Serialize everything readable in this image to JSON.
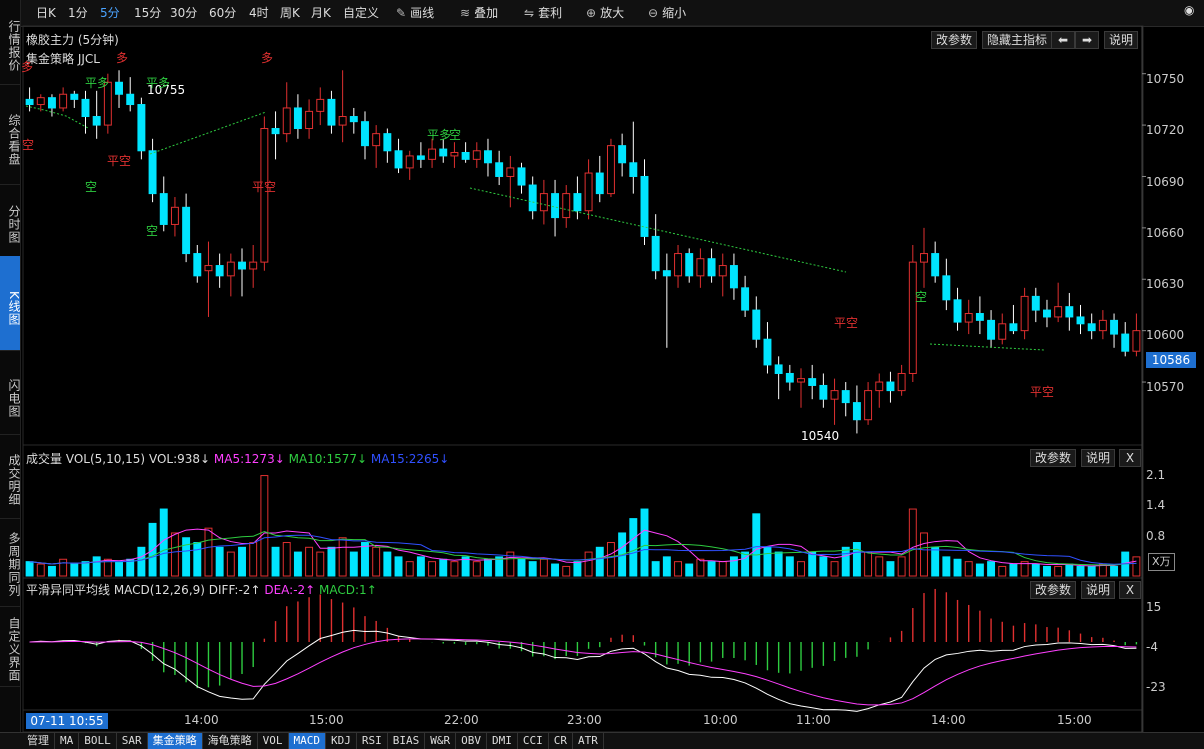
{
  "toolbar": {
    "items": [
      "日K",
      "1分",
      "5分",
      "15分",
      "30分",
      "60分",
      "4时",
      "周K",
      "月K",
      "自定义"
    ],
    "active_index": 2,
    "draw_label": "画线",
    "overlay_label": "叠加",
    "arbitrage_label": "套利",
    "zoom_in_label": "放大",
    "zoom_out_label": "缩小"
  },
  "left_tabs": [
    "行情报价",
    "综合看盘",
    "分时图",
    "K线图",
    "闪电图",
    "成交明细",
    "多周期同列",
    "自定义界面"
  ],
  "left_active_index": 3,
  "main_panel": {
    "title": "橡胶主力 (5分钟)",
    "strategy": "集金策略 JJCL",
    "btn_params": "改参数",
    "btn_hide": "隐藏主指标",
    "btn_help": "说明",
    "high_label": "10755",
    "low_label": "10540",
    "current_price": "10586",
    "y_labels": [
      "10750",
      "10720",
      "10690",
      "10660",
      "10630",
      "10600",
      "10570"
    ]
  },
  "signals": [
    {
      "text": "多",
      "color": "#e03030"
    },
    {
      "text": "空",
      "color": "#e03030"
    },
    {
      "text": "平多",
      "color": "#2ecc40"
    },
    {
      "text": "空",
      "color": "#2ecc40"
    },
    {
      "text": "多",
      "color": "#e03030"
    },
    {
      "text": "平空",
      "color": "#e03030"
    },
    {
      "text": "平多",
      "color": "#2ecc40"
    },
    {
      "text": "空",
      "color": "#2ecc40"
    },
    {
      "text": "多",
      "color": "#e03030"
    },
    {
      "text": "平空",
      "color": "#e03030"
    },
    {
      "text": "平多",
      "color": "#2ecc40"
    },
    {
      "text": "空",
      "color": "#2ecc40"
    },
    {
      "text": "平空",
      "color": "#e03030"
    },
    {
      "text": "空",
      "color": "#2ecc40"
    },
    {
      "text": "平空",
      "color": "#e03030"
    }
  ],
  "volume_panel": {
    "title": "成交量 VOL(5,10,15)",
    "vol": "VOL:938↓",
    "ma5": "MA5:1273↓",
    "ma10": "MA10:1577↓",
    "ma15": "MA15:2265↓",
    "btn_params": "改参数",
    "btn_help": "说明",
    "btn_close": "X",
    "unit": "X万",
    "y_labels": [
      "2.1",
      "1.4",
      "0.8"
    ]
  },
  "macd_panel": {
    "title": "平滑异同平均线 MACD(12,26,9)",
    "diff": "DIFF:-2↑",
    "dea": "DEA:-2↑",
    "macd": "MACD:1↑",
    "btn_params": "改参数",
    "btn_help": "说明",
    "btn_close": "X",
    "y_labels": [
      "15",
      "-4",
      "-23"
    ]
  },
  "time_axis": {
    "current": "07-11 10:55",
    "labels": [
      "14:00",
      "15:00",
      "22:00",
      "23:00",
      "10:00",
      "11:00",
      "14:00",
      "15:00"
    ]
  },
  "bottom_tabs": [
    "管理",
    "MA",
    "BOLL",
    "SAR",
    "集金策略",
    "海龟策略",
    "VOL",
    "MACD",
    "KDJ",
    "RSI",
    "BIAS",
    "W&R",
    "OBV",
    "DMI",
    "CCI",
    "CR",
    "ATR"
  ],
  "bottom_active": [
    4,
    7
  ],
  "colors": {
    "up": "#e03030",
    "down": "#00e5ff",
    "ma5": "#ff40ff",
    "ma10": "#2ecc40",
    "ma15": "#3050ff",
    "diff": "#ffffff",
    "dea": "#ff40ff"
  },
  "chart_data": {
    "type": "candlestick",
    "price_ylim": [
      10535,
      10765
    ],
    "ohlc": [
      [
        10735,
        10742,
        10728,
        10732
      ],
      [
        10732,
        10738,
        10728,
        10736
      ],
      [
        10736,
        10738,
        10725,
        10730
      ],
      [
        10730,
        10742,
        10728,
        10738
      ],
      [
        10738,
        10740,
        10730,
        10735
      ],
      [
        10735,
        10740,
        10715,
        10725
      ],
      [
        10725,
        10740,
        10712,
        10720
      ],
      [
        10720,
        10750,
        10715,
        10745
      ],
      [
        10745,
        10752,
        10730,
        10738
      ],
      [
        10738,
        10748,
        10728,
        10732
      ],
      [
        10732,
        10736,
        10700,
        10705
      ],
      [
        10705,
        10712,
        10675,
        10680
      ],
      [
        10680,
        10690,
        10658,
        10662
      ],
      [
        10662,
        10678,
        10655,
        10672
      ],
      [
        10672,
        10680,
        10640,
        10645
      ],
      [
        10645,
        10650,
        10628,
        10632
      ],
      [
        10635,
        10652,
        10608,
        10638
      ],
      [
        10638,
        10645,
        10625,
        10632
      ],
      [
        10632,
        10645,
        10620,
        10640
      ],
      [
        10640,
        10648,
        10620,
        10636
      ],
      [
        10636,
        10650,
        10625,
        10640
      ],
      [
        10640,
        10725,
        10635,
        10718
      ],
      [
        10718,
        10728,
        10700,
        10715
      ],
      [
        10715,
        10745,
        10710,
        10730
      ],
      [
        10730,
        10738,
        10712,
        10718
      ],
      [
        10718,
        10735,
        10712,
        10728
      ],
      [
        10728,
        10742,
        10720,
        10735
      ],
      [
        10735,
        10740,
        10715,
        10720
      ],
      [
        10720,
        10752,
        10710,
        10725
      ],
      [
        10725,
        10730,
        10715,
        10722
      ],
      [
        10722,
        10728,
        10700,
        10708
      ],
      [
        10708,
        10720,
        10695,
        10715
      ],
      [
        10715,
        10718,
        10698,
        10705
      ],
      [
        10705,
        10712,
        10692,
        10695
      ],
      [
        10695,
        10705,
        10688,
        10702
      ],
      [
        10702,
        10710,
        10695,
        10700
      ],
      [
        10700,
        10712,
        10695,
        10706
      ],
      [
        10706,
        10712,
        10698,
        10702
      ],
      [
        10702,
        10710,
        10695,
        10704
      ],
      [
        10704,
        10710,
        10698,
        10700
      ],
      [
        10700,
        10710,
        10695,
        10705
      ],
      [
        10705,
        10712,
        10690,
        10698
      ],
      [
        10698,
        10705,
        10685,
        10690
      ],
      [
        10690,
        10702,
        10672,
        10695
      ],
      [
        10695,
        10698,
        10680,
        10685
      ],
      [
        10685,
        10690,
        10665,
        10670
      ],
      [
        10670,
        10688,
        10662,
        10680
      ],
      [
        10680,
        10688,
        10655,
        10666
      ],
      [
        10666,
        10685,
        10660,
        10680
      ],
      [
        10680,
        10690,
        10665,
        10670
      ],
      [
        10670,
        10700,
        10665,
        10692
      ],
      [
        10692,
        10702,
        10675,
        10680
      ],
      [
        10680,
        10712,
        10678,
        10708
      ],
      [
        10708,
        10715,
        10690,
        10698
      ],
      [
        10698,
        10722,
        10680,
        10690
      ],
      [
        10690,
        10700,
        10650,
        10655
      ],
      [
        10655,
        10668,
        10630,
        10635
      ],
      [
        10635,
        10645,
        10590,
        10632
      ],
      [
        10632,
        10650,
        10625,
        10645
      ],
      [
        10645,
        10648,
        10628,
        10632
      ],
      [
        10632,
        10648,
        10625,
        10642
      ],
      [
        10642,
        10648,
        10628,
        10632
      ],
      [
        10632,
        10645,
        10620,
        10638
      ],
      [
        10638,
        10645,
        10618,
        10625
      ],
      [
        10625,
        10632,
        10608,
        10612
      ],
      [
        10612,
        10620,
        10590,
        10595
      ],
      [
        10595,
        10605,
        10575,
        10580
      ],
      [
        10580,
        10585,
        10560,
        10575
      ],
      [
        10575,
        10580,
        10565,
        10570
      ],
      [
        10570,
        10578,
        10555,
        10572
      ],
      [
        10572,
        10580,
        10560,
        10568
      ],
      [
        10568,
        10575,
        10555,
        10560
      ],
      [
        10560,
        10572,
        10545,
        10565
      ],
      [
        10565,
        10570,
        10550,
        10558
      ],
      [
        10558,
        10568,
        10540,
        10548
      ],
      [
        10548,
        10570,
        10545,
        10565
      ],
      [
        10565,
        10575,
        10555,
        10570
      ],
      [
        10570,
        10576,
        10558,
        10565
      ],
      [
        10565,
        10580,
        10562,
        10575
      ],
      [
        10575,
        10650,
        10570,
        10640
      ],
      [
        10640,
        10660,
        10625,
        10645
      ],
      [
        10645,
        10652,
        10628,
        10632
      ],
      [
        10632,
        10642,
        10612,
        10618
      ],
      [
        10618,
        10625,
        10600,
        10605
      ],
      [
        10605,
        10618,
        10598,
        10610
      ],
      [
        10610,
        10620,
        10598,
        10606
      ],
      [
        10606,
        10612,
        10590,
        10595
      ],
      [
        10595,
        10610,
        10592,
        10604
      ],
      [
        10604,
        10615,
        10598,
        10600
      ],
      [
        10600,
        10625,
        10595,
        10620
      ],
      [
        10620,
        10625,
        10605,
        10612
      ],
      [
        10612,
        10618,
        10602,
        10608
      ],
      [
        10608,
        10628,
        10605,
        10614
      ],
      [
        10614,
        10622,
        10600,
        10608
      ],
      [
        10608,
        10615,
        10598,
        10604
      ],
      [
        10604,
        10610,
        10595,
        10600
      ],
      [
        10600,
        10612,
        10595,
        10606
      ],
      [
        10606,
        10610,
        10590,
        10598
      ],
      [
        10598,
        10605,
        10585,
        10588
      ],
      [
        10588,
        10610,
        10585,
        10600
      ]
    ],
    "volume": [
      0.3,
      0.25,
      0.2,
      0.35,
      0.25,
      0.3,
      0.4,
      0.35,
      0.3,
      0.35,
      0.6,
      1.1,
      1.4,
      0.9,
      0.8,
      0.7,
      1.0,
      0.6,
      0.5,
      0.6,
      0.7,
      2.1,
      0.6,
      0.7,
      0.5,
      0.6,
      0.5,
      0.6,
      0.8,
      0.5,
      0.7,
      0.6,
      0.5,
      0.4,
      0.3,
      0.4,
      0.3,
      0.35,
      0.3,
      0.4,
      0.3,
      0.35,
      0.4,
      0.5,
      0.35,
      0.3,
      0.35,
      0.25,
      0.2,
      0.3,
      0.5,
      0.6,
      0.7,
      0.9,
      1.2,
      1.4,
      0.3,
      0.4,
      0.3,
      0.25,
      0.35,
      0.3,
      0.3,
      0.4,
      0.5,
      1.3,
      0.6,
      0.5,
      0.4,
      0.3,
      0.5,
      0.4,
      0.3,
      0.6,
      0.7,
      0.5,
      0.4,
      0.3,
      0.4,
      1.4,
      0.9,
      0.6,
      0.4,
      0.35,
      0.3,
      0.25,
      0.3,
      0.2,
      0.25,
      0.3,
      0.25,
      0.2,
      0.2,
      0.25,
      0.2,
      0.2,
      0.25,
      0.2,
      0.5,
      0.4
    ],
    "vol_ylim": [
      0,
      2.3
    ],
    "macd_ylim": [
      -30,
      20
    ]
  }
}
